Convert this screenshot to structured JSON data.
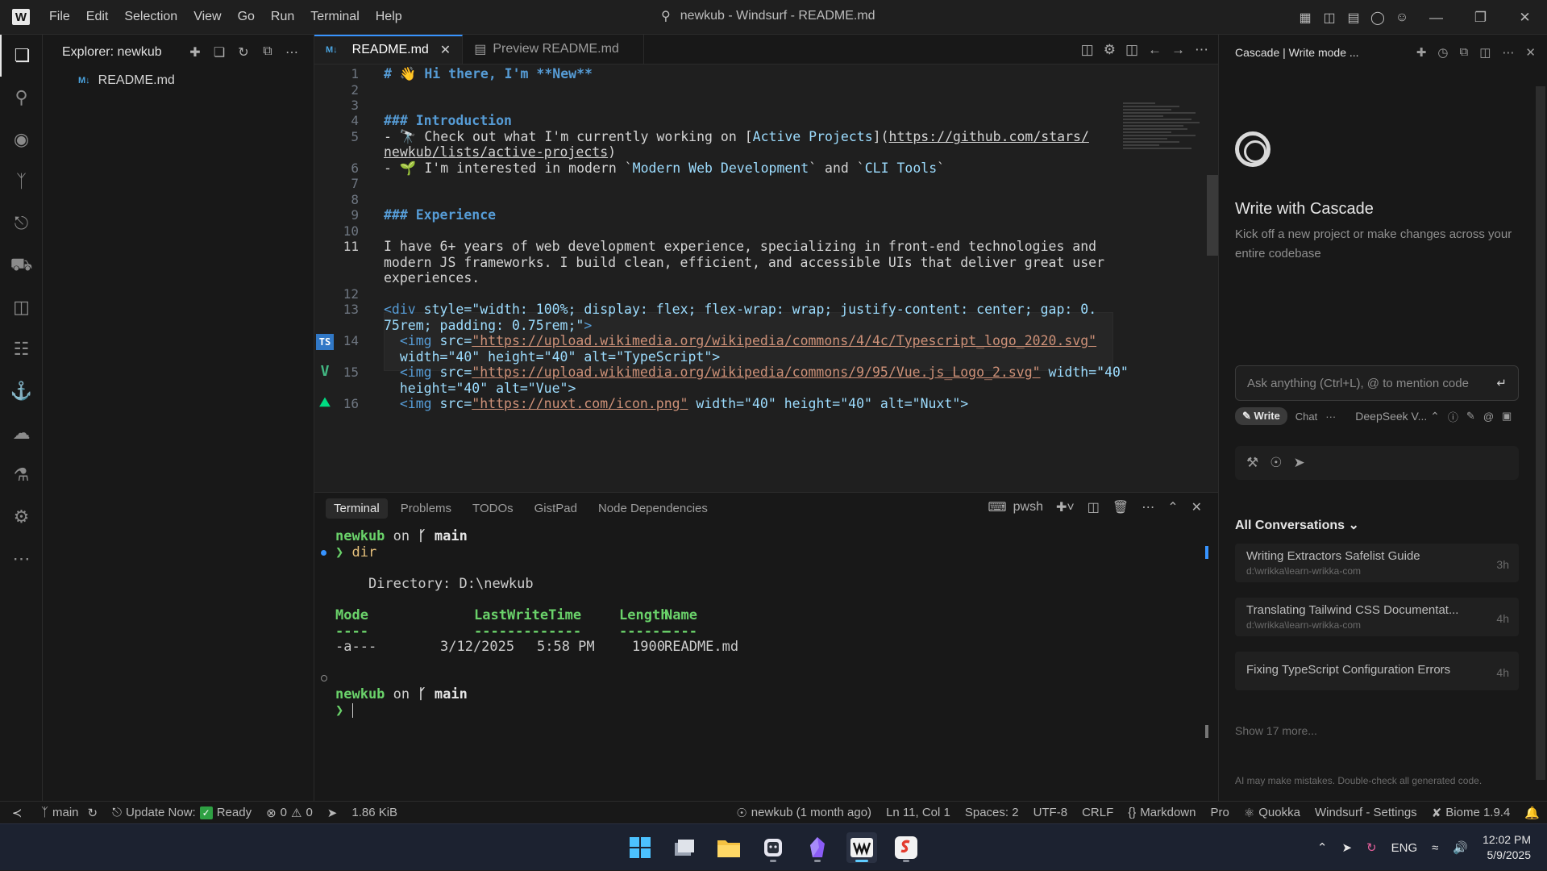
{
  "titlebar": {
    "menu": [
      "File",
      "Edit",
      "Selection",
      "View",
      "Go",
      "Run",
      "Terminal",
      "Help"
    ],
    "window_title": "newkub - Windsurf - README.md",
    "icons": [
      "layout-icon",
      "sidebar-icon",
      "panel-icon",
      "windsurf-icon",
      "account-icon"
    ]
  },
  "activity_bar": {
    "items": [
      "explorer-icon",
      "search-icon",
      "copilot-icon",
      "source-control-icon",
      "remote-icon",
      "database-icon",
      "extensions-icon",
      "diagram-icon",
      "docker-whale-icon",
      "cloud-icon",
      "testing-icon",
      "docker-icon",
      "more-icon"
    ]
  },
  "sidebar": {
    "title": "Explorer: newkub",
    "files": [
      {
        "tag": "M↓",
        "name": "README.md"
      }
    ]
  },
  "editor": {
    "tabs": [
      {
        "label": "README.md",
        "icon": "M↓",
        "active": true
      },
      {
        "label": "Preview README.md",
        "icon": "▤",
        "active": false
      }
    ],
    "line_numbers": [
      "1",
      "2",
      "3",
      "4",
      "5",
      "6",
      "7",
      "8",
      "9",
      "10",
      "11",
      "12",
      "13",
      "14",
      "15",
      "16"
    ],
    "gutter_labels": {
      "ts": "TS",
      "vue": "V",
      "nuxt": "⛰"
    },
    "lines": {
      "l1": "# 👋 Hi there, I'm **New**",
      "l4": "### Introduction",
      "l5a_prefix": "- 🔭 Check out what I'm currently working on [",
      "l5a_link": "Active Projects",
      "l5a_mid": "](",
      "l5a_url": "https://github.com/stars/",
      "l5b_url": "newkub/lists/active-projects",
      "l5b_end": ")",
      "l6_prefix": "- 🌱 I'm interested in modern `",
      "l6_code1": "Modern Web Development",
      "l6_mid": "` and `",
      "l6_code2": "CLI Tools",
      "l6_end": "`",
      "l9": "### Experience",
      "l11a": "I have 6+ years of web development experience, specializing in front-end technologies and",
      "l11b": "modern JS frameworks. I build clean, efficient, and accessible UIs that deliver great user",
      "l11c": "experiences.",
      "l13a_tag": "<div",
      "l13a_attr": " style=",
      "l13a_str": "\"width: 100%; display: flex; flex-wrap: wrap; justify-content: center; gap: 0.",
      "l13b_str": "75rem; padding: 0.75rem;\"",
      "l13b_end": ">",
      "l14a_tag": "  <img",
      "l14a_attr": " src=",
      "l14a_url": "\"https://upload.wikimedia.org/wikipedia/commons/4/4c/Typescript_logo_2020.svg\"",
      "l14b": "  width=\"40\" height=\"40\" alt=\"TypeScript\">",
      "l15a_tag": "  <img",
      "l15a_attr": " src=",
      "l15a_url": "\"https://upload.wikimedia.org/wikipedia/commons/9/95/Vue.js_Logo_2.svg\"",
      "l15a_rest": " width=\"40\"",
      "l15b": "  height=\"40\" alt=\"Vue\">",
      "l16_tag": "  <img",
      "l16_attr": " src=",
      "l16_url": "\"https://nuxt.com/icon.png\"",
      "l16_rest": " width=\"40\" height=\"40\" alt=\"Nuxt\">"
    }
  },
  "panel": {
    "tabs": [
      "Terminal",
      "Problems",
      "TODOs",
      "GistPad",
      "Node Dependencies"
    ],
    "shell": "pwsh",
    "terminal": {
      "user": "newkub",
      "on": "on",
      "branch_icon": "ᚴ",
      "branch": "main",
      "prompt": "❯",
      "command": "dir",
      "directory_line": "    Directory: D:\\newkub",
      "header": {
        "mode": "Mode",
        "lastwrite": "LastWriteTime",
        "length": "Length",
        "name": "Name"
      },
      "underline": {
        "mode": "----",
        "lastwrite": "-------------",
        "length": "------",
        "name": "----"
      },
      "row": {
        "mode": "-a---",
        "date": "3/12/2025",
        "time": "5:58 PM",
        "length": "1900",
        "name": "README.md"
      }
    }
  },
  "cascade": {
    "header_title": "Cascade | Write mode ...",
    "title": "Write with Cascade",
    "subtitle": "Kick off a new project or make changes across your entire codebase",
    "input_placeholder": "Ask anything (Ctrl+L), @ to mention code",
    "mode_write": "Write",
    "mode_chat": "Chat",
    "more": "···",
    "model": "DeepSeek V...",
    "all_conversations": "All Conversations",
    "conversations": [
      {
        "title": "Writing Extractors Safelist Guide",
        "path": "d:\\wrikka\\learn-wrikka-com",
        "age": "3h"
      },
      {
        "title": "Translating Tailwind CSS Documentat...",
        "path": "d:\\wrikka\\learn-wrikka-com",
        "age": "4h"
      },
      {
        "title": "Fixing TypeScript Configuration Errors",
        "path": "",
        "age": "4h"
      }
    ],
    "show_more": "Show 17 more...",
    "disclaimer": "AI may make mistakes. Double-check all generated code."
  },
  "statusbar": {
    "branch": "main",
    "update": "Update Now:",
    "ready": "Ready",
    "errors": "0",
    "warnings": "0",
    "size": "1.86 KiB",
    "git_author": "newkub (1 month ago)",
    "position": "Ln 11, Col 1",
    "spaces": "Spaces: 2",
    "encoding": "UTF-8",
    "eol": "CRLF",
    "language": "Markdown",
    "pro": "Pro",
    "quokka": "Quokka",
    "settings": "Windsurf - Settings",
    "biome": "Biome 1.9.4"
  },
  "taskbar": {
    "apps": [
      "start-icon",
      "task-view-icon",
      "file-explorer-icon",
      "app-icon",
      "obsidian-icon",
      "windsurf-icon",
      "app-s-icon"
    ],
    "lang": "ENG",
    "time": "12:02 PM",
    "date": "5/9/2025"
  }
}
